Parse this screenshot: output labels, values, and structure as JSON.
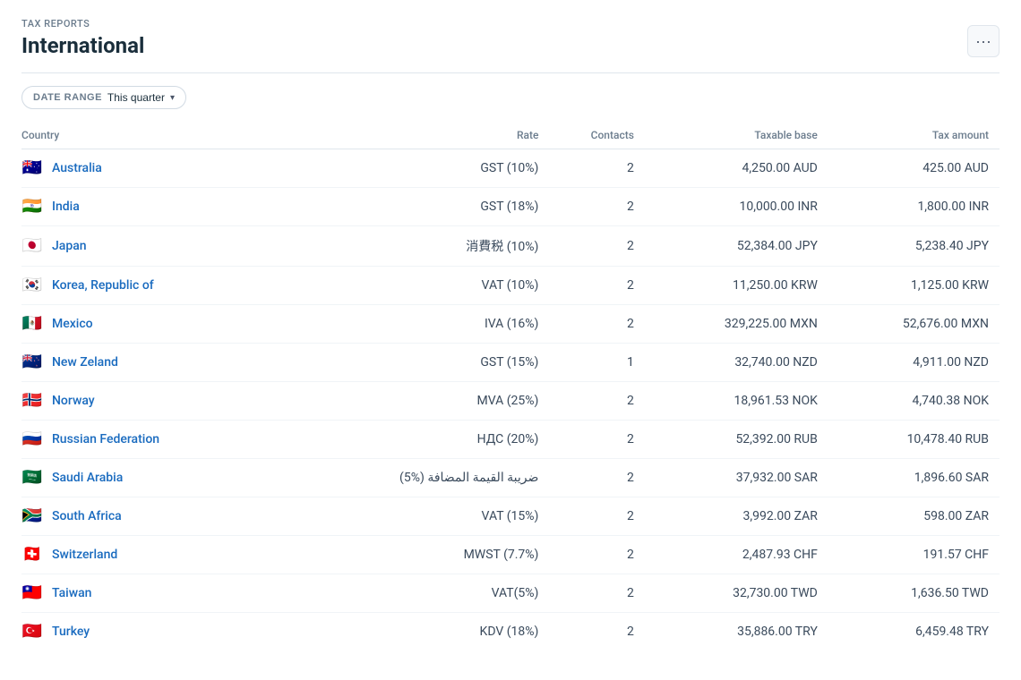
{
  "breadcrumb": "TAX REPORTS",
  "title": "International",
  "more_btn_label": "···",
  "filter": {
    "date_range_label": "DATE RANGE",
    "date_range_value": "This quarter",
    "chevron": "▾"
  },
  "table": {
    "columns": [
      "Country",
      "Rate",
      "Contacts",
      "Taxable base",
      "Tax amount"
    ],
    "rows": [
      {
        "flag": "🇦🇺",
        "country": "Australia",
        "rate": "GST (10%)",
        "contacts": "2",
        "taxable_base": "4,250.00 AUD",
        "tax_amount": "425.00 AUD"
      },
      {
        "flag": "🇮🇳",
        "country": "India",
        "rate": "GST (18%)",
        "contacts": "2",
        "taxable_base": "10,000.00 INR",
        "tax_amount": "1,800.00 INR"
      },
      {
        "flag": "🇯🇵",
        "country": "Japan",
        "rate": "消費税 (10%)",
        "contacts": "2",
        "taxable_base": "52,384.00 JPY",
        "tax_amount": "5,238.40 JPY"
      },
      {
        "flag": "🇰🇷",
        "country": "Korea, Republic of",
        "rate": "VAT (10%)",
        "contacts": "2",
        "taxable_base": "11,250.00 KRW",
        "tax_amount": "1,125.00 KRW"
      },
      {
        "flag": "🇲🇽",
        "country": "Mexico",
        "rate": "IVA (16%)",
        "contacts": "2",
        "taxable_base": "329,225.00 MXN",
        "tax_amount": "52,676.00 MXN"
      },
      {
        "flag": "🇳🇿",
        "country": "New Zeland",
        "rate": "GST (15%)",
        "contacts": "1",
        "taxable_base": "32,740.00 NZD",
        "tax_amount": "4,911.00 NZD"
      },
      {
        "flag": "🇳🇴",
        "country": "Norway",
        "rate": "MVA (25%)",
        "contacts": "2",
        "taxable_base": "18,961.53 NOK",
        "tax_amount": "4,740.38 NOK"
      },
      {
        "flag": "🇷🇺",
        "country": "Russian Federation",
        "rate": "НДС (20%)",
        "contacts": "2",
        "taxable_base": "52,392.00 RUB",
        "tax_amount": "10,478.40 RUB"
      },
      {
        "flag": "🇸🇦",
        "country": "Saudi Arabia",
        "rate": "ضريبة القيمة المضافة (%5)",
        "contacts": "2",
        "taxable_base": "37,932.00 SAR",
        "tax_amount": "1,896.60 SAR"
      },
      {
        "flag": "🇿🇦",
        "country": "South Africa",
        "rate": "VAT (15%)",
        "contacts": "2",
        "taxable_base": "3,992.00 ZAR",
        "tax_amount": "598.00 ZAR"
      },
      {
        "flag": "🇨🇭",
        "country": "Switzerland",
        "rate": "MWST (7.7%)",
        "contacts": "2",
        "taxable_base": "2,487.93 CHF",
        "tax_amount": "191.57 CHF"
      },
      {
        "flag": "🇹🇼",
        "country": "Taiwan",
        "rate": "VAT(5%)",
        "contacts": "2",
        "taxable_base": "32,730.00 TWD",
        "tax_amount": "1,636.50 TWD"
      },
      {
        "flag": "🇹🇷",
        "country": "Turkey",
        "rate": "KDV (18%)",
        "contacts": "2",
        "taxable_base": "35,886.00 TRY",
        "tax_amount": "6,459.48 TRY"
      }
    ]
  }
}
